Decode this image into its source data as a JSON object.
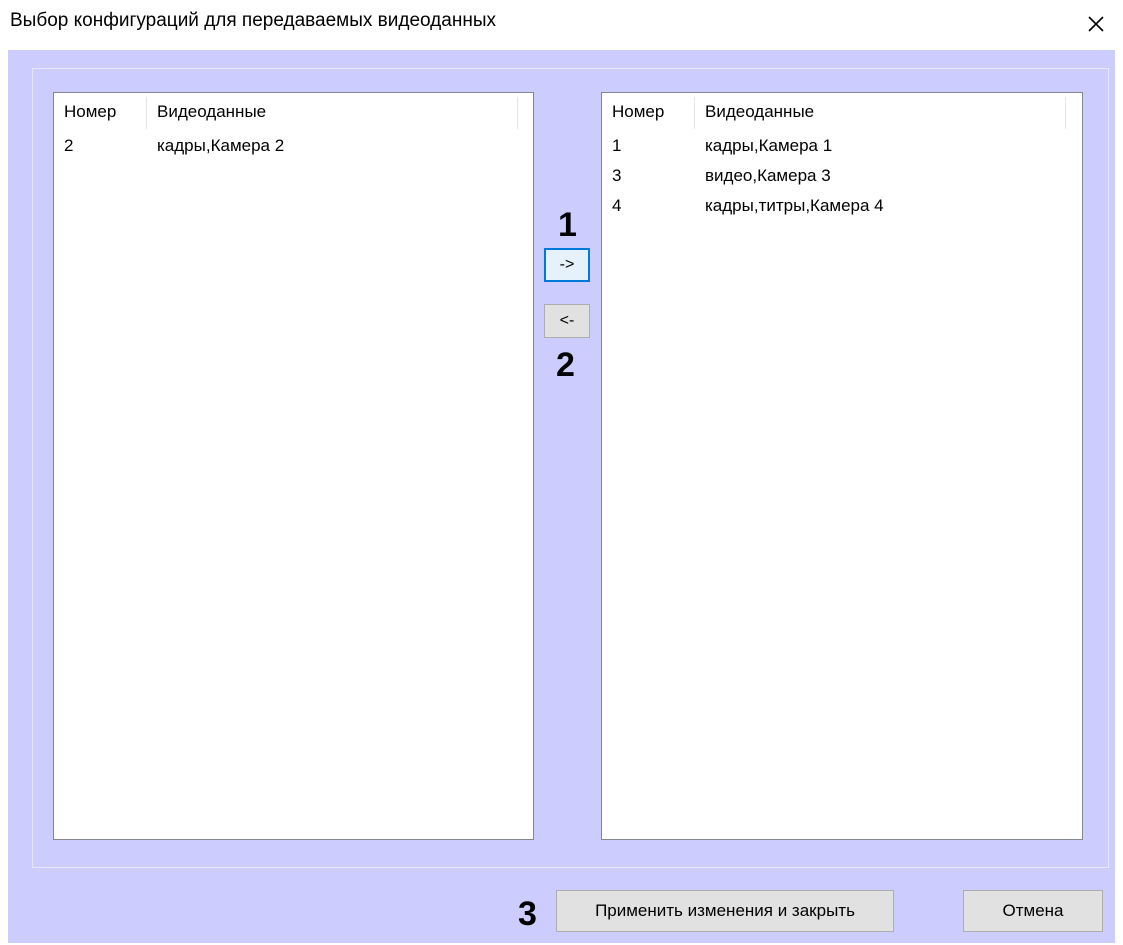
{
  "window": {
    "title": "Выбор конфигураций для передаваемых видеоданных",
    "close_glyph": "✕"
  },
  "left_list": {
    "columns": [
      "Номер",
      "Видеоданные"
    ],
    "rows": [
      {
        "number": "2",
        "data": "кадры,Камера 2"
      }
    ]
  },
  "right_list": {
    "columns": [
      "Номер",
      "Видеоданные"
    ],
    "rows": [
      {
        "number": "1",
        "data": "кадры,Камера 1"
      },
      {
        "number": "3",
        "data": "видео,Камера 3"
      },
      {
        "number": "4",
        "data": "кадры,титры,Камера 4"
      }
    ]
  },
  "buttons": {
    "move_right": "->",
    "move_left": "<-",
    "apply": "Применить изменения и закрыть",
    "cancel": "Отмена"
  },
  "callouts": {
    "one": "1",
    "two": "2",
    "three": "3"
  },
  "colors": {
    "dialog_background": "#ccccff",
    "focus_border": "#0078d7"
  }
}
